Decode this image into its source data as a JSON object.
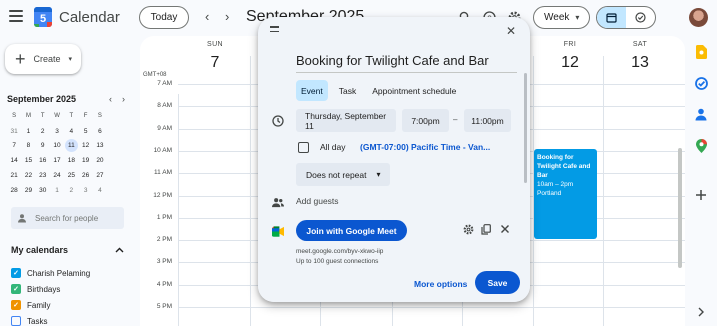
{
  "app": {
    "name": "Calendar",
    "logo_day": "5"
  },
  "toolbar": {
    "today_label": "Today",
    "prev_label": "‹",
    "next_label": "›",
    "current_period": "September 2025",
    "view_label": "Week",
    "view_arrow": "▾"
  },
  "sidebar": {
    "create_label": "Create",
    "create_arrow": "▾",
    "mini_calendar": {
      "month_label": "September 2025",
      "prev": "‹",
      "next": "›",
      "weekdays": [
        "S",
        "M",
        "T",
        "W",
        "T",
        "F",
        "S"
      ],
      "days": [
        "31",
        "1",
        "2",
        "3",
        "4",
        "5",
        "6",
        "7",
        "8",
        "9",
        "10",
        "11",
        "12",
        "13",
        "14",
        "15",
        "16",
        "17",
        "18",
        "19",
        "20",
        "21",
        "22",
        "23",
        "24",
        "25",
        "26",
        "27",
        "28",
        "29",
        "30",
        "1",
        "2",
        "3",
        "4"
      ],
      "selected_day": "11"
    },
    "search_people_placeholder": "Search for people",
    "my_calendars_label": "My calendars",
    "my_calendars_chevron": "^",
    "calendars": [
      {
        "name": "Charish Pelaming",
        "color": "#039be5",
        "checked": true
      },
      {
        "name": "Birthdays",
        "color": "#33b679",
        "checked": true
      },
      {
        "name": "Family",
        "color": "#f09300",
        "checked": true
      },
      {
        "name": "Tasks",
        "color": "#4285f4",
        "checked": false
      }
    ]
  },
  "week_view": {
    "timezone_label": "GMT+08",
    "visible_days": [
      {
        "dow": "SUN",
        "date": "7"
      },
      {
        "dow": "FRI",
        "date": "12"
      },
      {
        "dow": "SAT",
        "date": "13"
      }
    ],
    "hours": [
      "7 AM",
      "8 AM",
      "9 AM",
      "10 AM",
      "11 AM",
      "12 PM",
      "1 PM",
      "2 PM",
      "3 PM",
      "4 PM",
      "5 PM"
    ],
    "event": {
      "title": "Booking for Twilight Cafe and Bar",
      "time": "10am – 2pm",
      "location": "Portland",
      "color": "#039be5"
    }
  },
  "dialog": {
    "close_label": "✕",
    "title": "Booking for Twilight Cafe and Bar",
    "tabs": [
      "Event",
      "Task",
      "Appointment schedule"
    ],
    "active_tab": "Event",
    "date": "Thursday, September 11",
    "start_time": "7:00pm",
    "dash": "–",
    "end_time": "11:00pm",
    "all_day_label": "All day",
    "timezone": "(GMT-07:00) Pacific Time - Van...",
    "repeat_label": "Does not repeat",
    "repeat_arrow": "▾",
    "add_guests_label": "Add guests",
    "meet_button_label": "Join with Google Meet",
    "meet_link": "meet.google.com/byv-xkwo-iip",
    "meet_capacity": "Up to 100 guest connections",
    "more_options_label": "More options",
    "save_label": "Save",
    "primary_color": "#0b57d0"
  }
}
